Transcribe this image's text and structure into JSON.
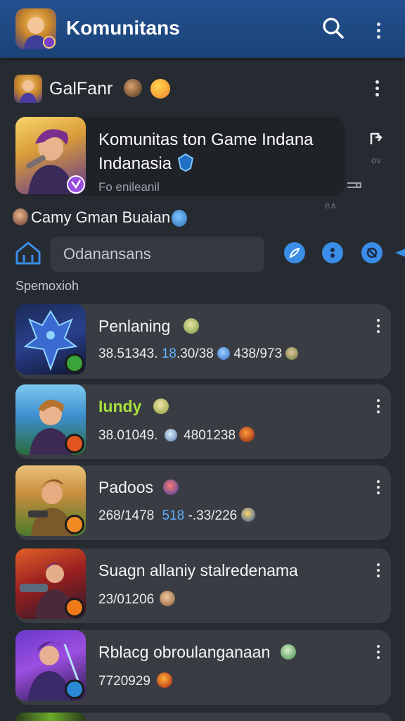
{
  "appbar": {
    "title": "Komunitans",
    "search_icon": "search-icon",
    "more_icon": "more-vertical-icon"
  },
  "group": {
    "name": "GalFanr",
    "more_icon": "more-vertical-icon"
  },
  "featured": {
    "title": "Komunitas ton Game Indana Indanasia",
    "subtitle": "Fo enileanil"
  },
  "side_icons": {
    "label_top": "ov",
    "label_bottom": "e∧"
  },
  "game_row": {
    "text": "Camy Gman Buaian"
  },
  "search": {
    "placeholder": "Odanansans",
    "home_icon": "home-icon"
  },
  "section": {
    "label": "Spemoxioh"
  },
  "items": [
    {
      "title": "Penlaning",
      "stats": [
        "38.51343.",
        "18",
        ".30/38",
        "438/973"
      ],
      "title_color": "#f4f5f7"
    },
    {
      "title": "Iundy",
      "stats": [
        "38.01049.",
        "4801238"
      ],
      "title_color": "#a7e23c"
    },
    {
      "title": "Padoos",
      "stats": [
        "268/1478",
        "518",
        "-.33/226"
      ],
      "title_color": "#f4f5f7"
    },
    {
      "title": "Suagn allaniy stalredenama",
      "stats": [
        "23/01206"
      ],
      "title_color": "#f4f5f7"
    },
    {
      "title": "Rblacg obroulanganaan",
      "stats": [
        "7720929"
      ],
      "title_color": "#f4f5f7"
    }
  ],
  "colors": {
    "appbar": "#1e4a86",
    "background": "#262a31",
    "card": "#393c42",
    "accent": "#3a8ee8",
    "highlight": "#5fb0ff"
  }
}
